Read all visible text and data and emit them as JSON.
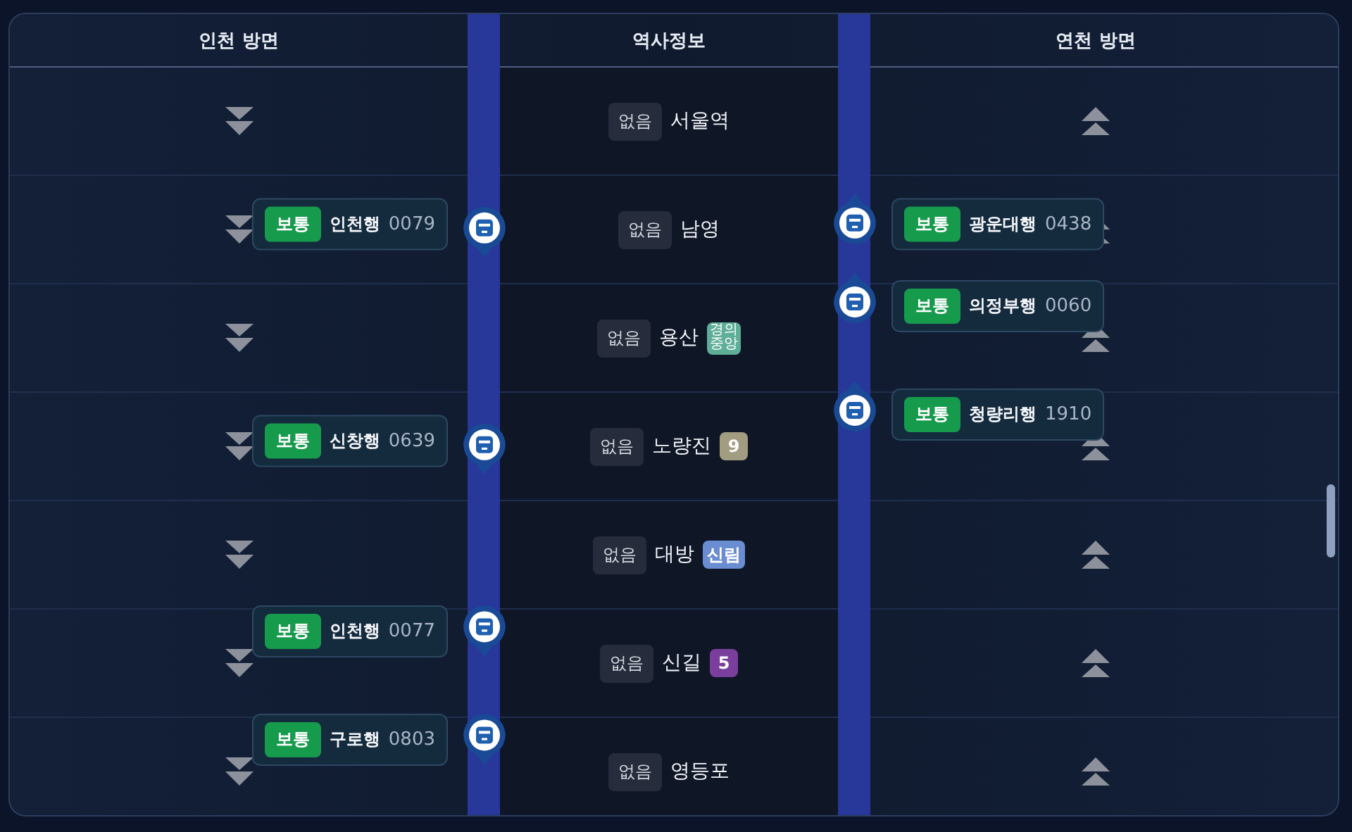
{
  "header": {
    "down_direction": "인천 방면",
    "station_info": "역사정보",
    "up_direction": "연천 방면"
  },
  "stations": [
    {
      "status": "없음",
      "name": "서울역"
    },
    {
      "status": "없음",
      "name": "남영",
      "down_train": {
        "grade": "보통",
        "destination": "인천행",
        "number": "0079",
        "at_station": true
      },
      "up_train": {
        "grade": "보통",
        "destination": "광운대행",
        "number": "0438",
        "at_station": true
      }
    },
    {
      "status": "없음",
      "name": "용산",
      "line": {
        "label": "경의중앙",
        "color": "#5fae98"
      },
      "up_train": {
        "grade": "보통",
        "destination": "의정부행",
        "number": "0060",
        "at_station": false
      }
    },
    {
      "status": "없음",
      "name": "노량진",
      "line": {
        "label": "9",
        "color": "#a29d80"
      },
      "down_train": {
        "grade": "보통",
        "destination": "신창행",
        "number": "0639",
        "at_station": true
      },
      "up_train": {
        "grade": "보통",
        "destination": "청량리행",
        "number": "1910",
        "at_station": false
      }
    },
    {
      "status": "없음",
      "name": "대방",
      "line": {
        "label": "신림",
        "color": "#6a8cd0"
      }
    },
    {
      "status": "없음",
      "name": "신길",
      "line": {
        "label": "5",
        "color": "#7a3f9c"
      },
      "down_train": {
        "grade": "보통",
        "destination": "인천행",
        "number": "0077",
        "at_station": false
      }
    },
    {
      "status": "없음",
      "name": "영등포",
      "down_train": {
        "grade": "보통",
        "destination": "구로행",
        "number": "0803",
        "at_station": false
      }
    }
  ]
}
